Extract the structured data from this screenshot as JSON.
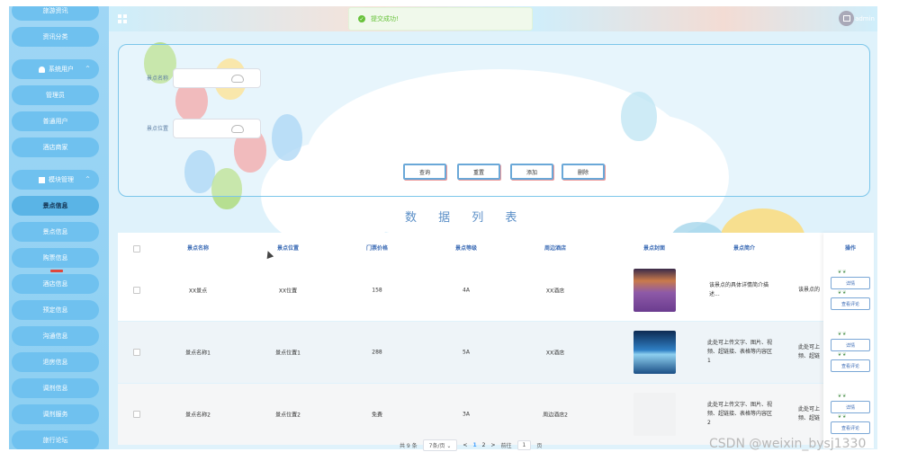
{
  "sidebar": {
    "items": [
      {
        "label": "旅游资讯"
      },
      {
        "label": "资讯分类"
      },
      {
        "label": "系统用户"
      },
      {
        "label": "管理员"
      },
      {
        "label": "普通用户"
      },
      {
        "label": "酒店商家"
      },
      {
        "label": "模块管理"
      },
      {
        "label": "景点信息"
      },
      {
        "label": "景点信息"
      },
      {
        "label": "购票信息"
      },
      {
        "label": "酒店信息"
      },
      {
        "label": "预定信息"
      },
      {
        "label": "沟通信息"
      },
      {
        "label": "退房信息"
      },
      {
        "label": "调剂信息"
      },
      {
        "label": "调剂服务"
      },
      {
        "label": "旅行论坛"
      }
    ]
  },
  "header": {
    "admin": "admin"
  },
  "toast": {
    "message": "提交成功!"
  },
  "search": {
    "name_label": "景点名称",
    "location_label": "景点位置",
    "buttons": {
      "query": "查询",
      "reset": "重置",
      "add": "添加",
      "delete": "删除"
    }
  },
  "list_title": "数 据 列 表",
  "table": {
    "headers": [
      "景点名称",
      "景点位置",
      "门票价格",
      "景点等级",
      "周边酒店",
      "景点封面",
      "景点简介",
      "操作"
    ],
    "rows": [
      {
        "name": "XX景点",
        "location": "XX位置",
        "price": "158",
        "level": "4A",
        "hotel": "XX酒店",
        "intro": "该景点的具体详情简介描述...",
        "intro2": "该景点的"
      },
      {
        "name": "景点名称1",
        "location": "景点位置1",
        "price": "288",
        "level": "5A",
        "hotel": "XX酒店",
        "intro": "此处可上传文字、图片、视频、超链接、表格等内容区1",
        "intro2": "此处可上 频、超链"
      },
      {
        "name": "景点名称2",
        "location": "景点位置2",
        "price": "免费",
        "level": "3A",
        "hotel": "周边酒店2",
        "intro": "此处可上传文字、图片、视频、超链接、表格等内容区2",
        "intro2": "此处可上 频、超链"
      }
    ],
    "op_detail": "详情",
    "op_comment": "查看评论"
  },
  "pager": {
    "total": "共 9 条",
    "size": "7条/页",
    "prev": "<",
    "p1": "1",
    "p2": "2",
    "next": ">",
    "goto": "前往",
    "page": "1",
    "unit": "页"
  },
  "watermark": "CSDN @weixin_bysj1330"
}
